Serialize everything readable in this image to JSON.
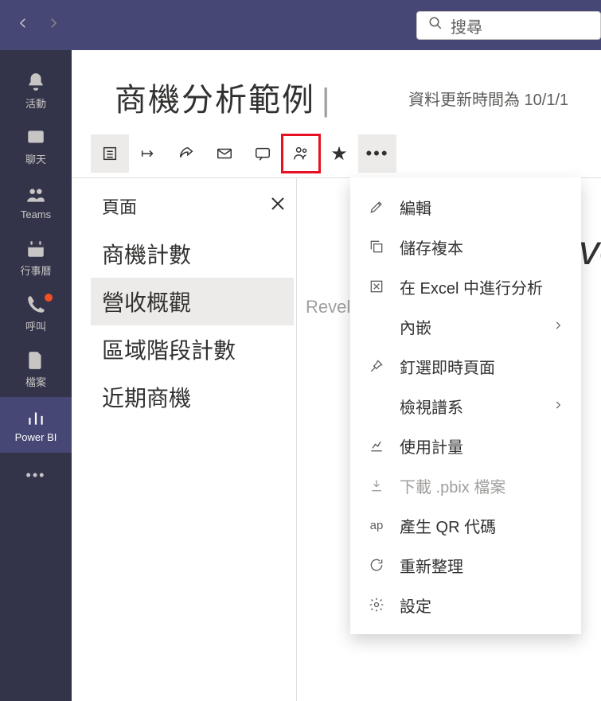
{
  "titlebar": {
    "search_placeholder": "搜尋"
  },
  "rail": {
    "items": [
      {
        "label": "活動"
      },
      {
        "label": "聊天"
      },
      {
        "label": "Teams"
      },
      {
        "label": "行事曆"
      },
      {
        "label": "呼叫"
      },
      {
        "label": "檔案"
      },
      {
        "label": "Power BI"
      }
    ]
  },
  "header": {
    "title": "商機分析範例",
    "refresh_text": "資料更新時間為 10/1/1"
  },
  "pages": {
    "heading": "頁面",
    "items": [
      "商機計數",
      "營收概觀",
      "區域階段計數",
      "近期商機"
    ],
    "selected_index": 1
  },
  "bg": {
    "revel": "Revel",
    "ve": "ve"
  },
  "menu": {
    "items": [
      {
        "label": "編輯"
      },
      {
        "label": "儲存複本"
      },
      {
        "label": "在 Excel 中進行分析"
      },
      {
        "label": "內嵌",
        "submenu": true
      },
      {
        "label": "釘選即時頁面"
      },
      {
        "label": "檢視譜系",
        "submenu": true
      },
      {
        "label": "使用計量"
      },
      {
        "label": "下載 .pbix 檔案",
        "disabled": true
      },
      {
        "label": "產生 QR 代碼",
        "prefix": "ap"
      },
      {
        "label": "重新整理"
      },
      {
        "label": "設定"
      }
    ]
  }
}
